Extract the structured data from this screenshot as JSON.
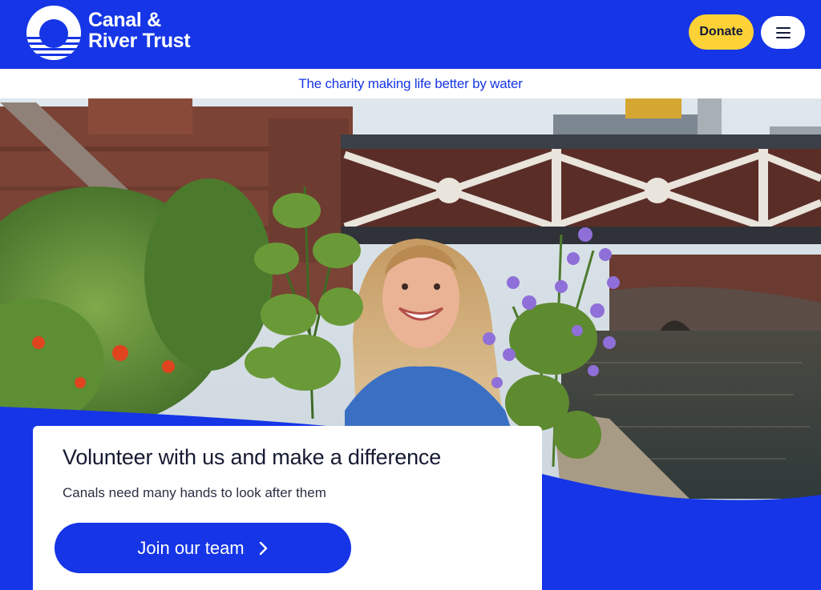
{
  "header": {
    "logo_line1": "Canal &",
    "logo_line2": "River Trust",
    "donate_label": "Donate",
    "menu_icon": "hamburger-menu-icon"
  },
  "tagline": "The charity making life better by water",
  "hero": {
    "image_icon": "volunteer-with-flowers-photo"
  },
  "card": {
    "title": "Volunteer with us and make a difference",
    "subtitle": "Canals need many hands to look after them",
    "cta_label": "Join our team",
    "cta_icon": "chevron-right-icon"
  },
  "colors": {
    "brand_blue": "#1535e6",
    "donate_yellow": "#fdd236",
    "white": "#ffffff"
  }
}
